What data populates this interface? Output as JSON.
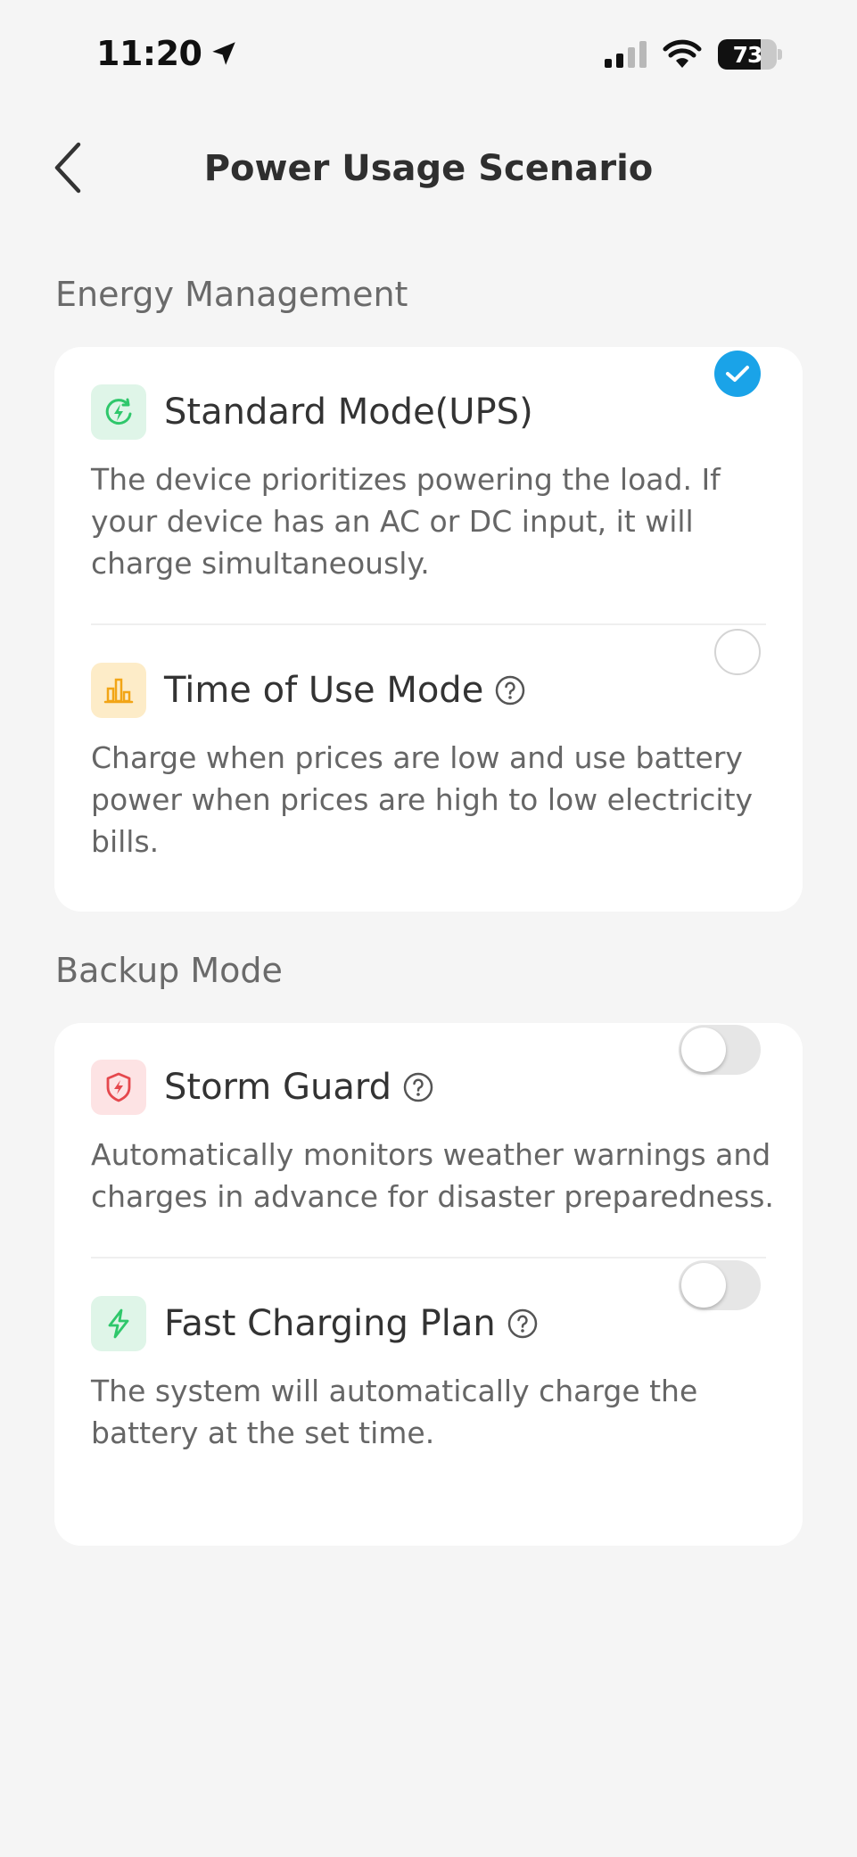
{
  "status_bar": {
    "time": "11:20",
    "battery_level": "73",
    "battery_fraction": 0.73,
    "icons": [
      "location-arrow-icon",
      "cellular-signal-icon",
      "wifi-icon",
      "battery-icon"
    ]
  },
  "header": {
    "title": "Power Usage Scenario",
    "back_icon": "chevron-left-icon"
  },
  "energy_management": {
    "title": "Energy Management",
    "items": [
      {
        "title": "Standard Mode(UPS)",
        "description": "The device prioritizes powering the load. If your device has an AC or DC input, it will charge simultaneously.",
        "icon": "lightning-circle-icon",
        "icon_color": "#2fc76b",
        "icon_bg": "#dff5e8",
        "selected": true
      },
      {
        "title": "Time of Use Mode",
        "description": "Charge when prices are low and use battery power when prices are high to low electricity bills.",
        "icon": "bar-chart-icon",
        "icon_color": "#f2a516",
        "icon_bg": "#fdecc8",
        "selected": false,
        "has_help": true
      }
    ]
  },
  "backup_mode": {
    "title": "Backup Mode",
    "items": [
      {
        "title": "Storm Guard",
        "description": "Automatically monitors weather warnings and charges in advance for disaster preparedness.",
        "icon": "shield-lightning-icon",
        "icon_color": "#e5484d",
        "icon_bg": "#fde3e4",
        "enabled": false,
        "has_help": true
      },
      {
        "title": "Fast Charging Plan",
        "description": "The system will automatically charge the battery at the set time.",
        "icon": "lightning-bolt-icon",
        "icon_color": "#2fc76b",
        "icon_bg": "#dff5e8",
        "enabled": false,
        "has_help": true
      }
    ]
  },
  "colors": {
    "accent": "#1aa3e8",
    "background": "#f5f5f5",
    "card": "#ffffff"
  }
}
